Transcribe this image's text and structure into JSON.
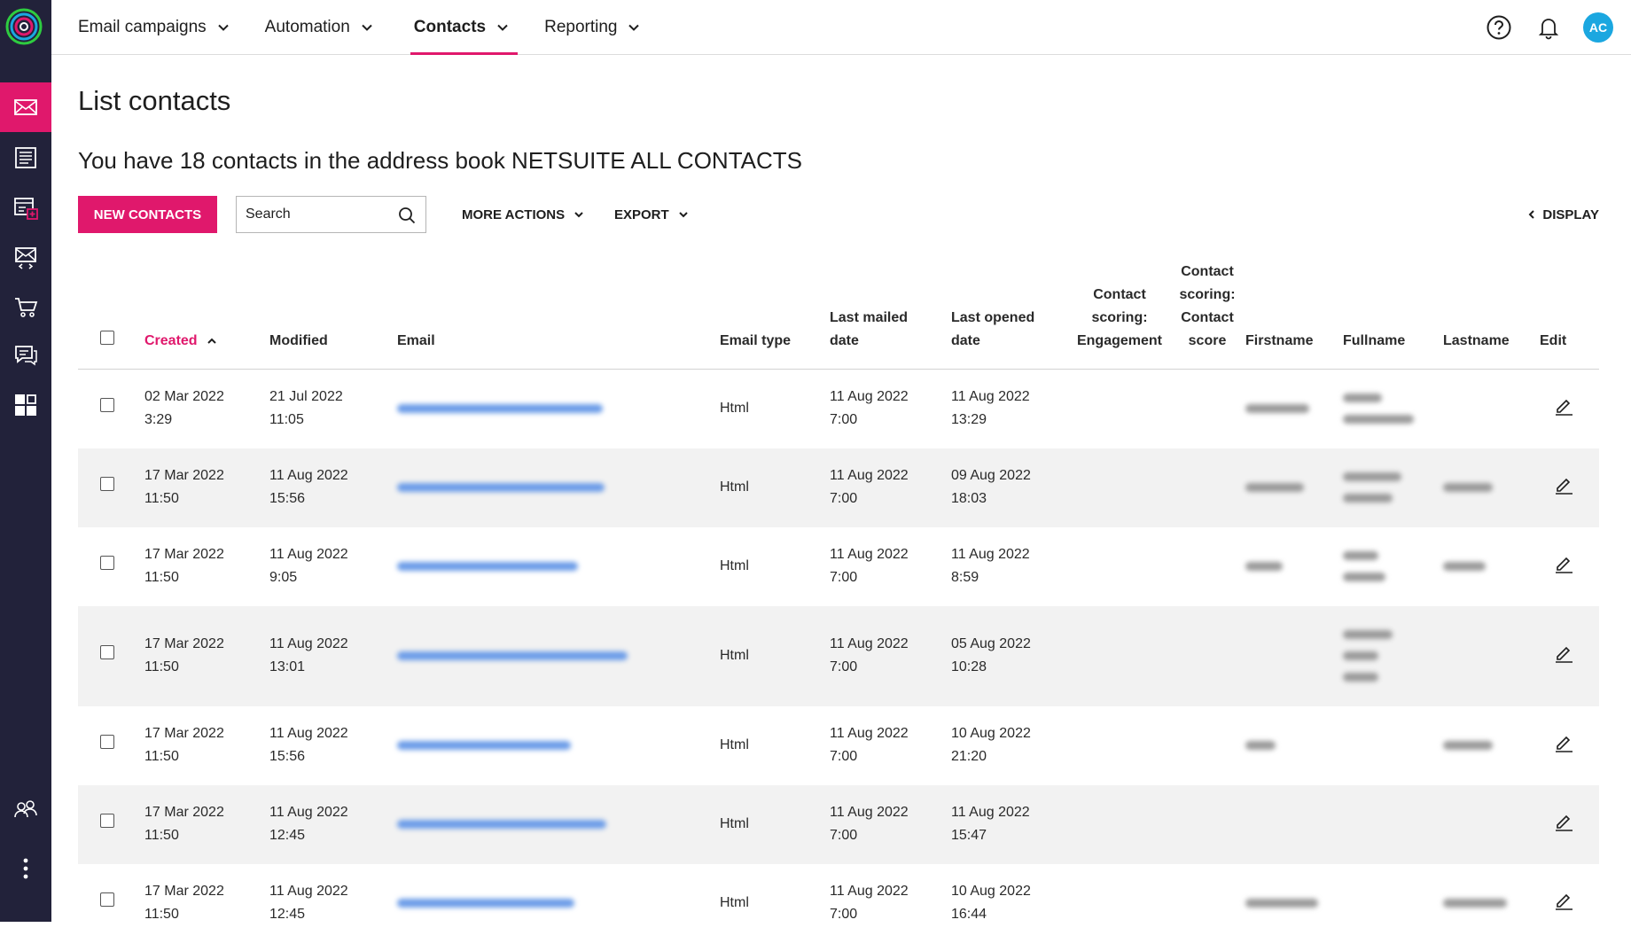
{
  "nav": {
    "items": [
      {
        "label": "Email campaigns",
        "active": false
      },
      {
        "label": "Automation",
        "active": false
      },
      {
        "label": "Contacts",
        "active": true
      },
      {
        "label": "Reporting",
        "active": false
      }
    ],
    "avatar_initials": "AC"
  },
  "colors": {
    "accent": "#e0186c",
    "rail": "#22223a",
    "avatar": "#1ba7e0"
  },
  "sidebar": {
    "icons": [
      "envelope-icon",
      "newsletter-icon",
      "forms-add-icon",
      "email-code-icon",
      "cart-icon",
      "chat-icon",
      "apps-grid-icon",
      "team-icon",
      "more-icon"
    ]
  },
  "page": {
    "title": "List contacts",
    "summary": "You have 18 contacts in the address book NETSUITE ALL CONTACTS"
  },
  "toolbar": {
    "new_contacts": "NEW CONTACTS",
    "search_placeholder": "Search",
    "more_actions": "MORE ACTIONS",
    "export": "EXPORT",
    "display": "DISPLAY"
  },
  "table": {
    "headers": {
      "created": "Created",
      "modified": "Modified",
      "email": "Email",
      "email_type": "Email type",
      "last_mailed_1": "Last mailed",
      "last_mailed_2": "date",
      "last_opened_1": "Last opened",
      "last_opened_2": "date",
      "engagement_1": "Contact",
      "engagement_2": "scoring:",
      "engagement_3": "Engagement",
      "score_1": "Contact",
      "score_2": "scoring:",
      "score_3": "Contact",
      "score_4": "score",
      "firstname": "Firstname",
      "fullname": "Fullname",
      "lastname": "Lastname",
      "edit": "Edit"
    },
    "rows": [
      {
        "created_d": "02 Mar 2022",
        "created_t": "3:29",
        "modified_d": "21 Jul 2022",
        "modified_t": "11:05",
        "email_type": "Html",
        "mailed_d": "11 Aug 2022",
        "mailed_t": "7:00",
        "opened_d": "11 Aug 2022",
        "opened_t": "13:29"
      },
      {
        "created_d": "17 Mar 2022",
        "created_t": "11:50",
        "modified_d": "11 Aug 2022",
        "modified_t": "15:56",
        "email_type": "Html",
        "mailed_d": "11 Aug 2022",
        "mailed_t": "7:00",
        "opened_d": "09 Aug 2022",
        "opened_t": "18:03"
      },
      {
        "created_d": "17 Mar 2022",
        "created_t": "11:50",
        "modified_d": "11 Aug 2022",
        "modified_t": "9:05",
        "email_type": "Html",
        "mailed_d": "11 Aug 2022",
        "mailed_t": "7:00",
        "opened_d": "11 Aug 2022",
        "opened_t": "8:59"
      },
      {
        "created_d": "17 Mar 2022",
        "created_t": "11:50",
        "modified_d": "11 Aug 2022",
        "modified_t": "13:01",
        "email_type": "Html",
        "mailed_d": "11 Aug 2022",
        "mailed_t": "7:00",
        "opened_d": "05 Aug 2022",
        "opened_t": "10:28"
      },
      {
        "created_d": "17 Mar 2022",
        "created_t": "11:50",
        "modified_d": "11 Aug 2022",
        "modified_t": "15:56",
        "email_type": "Html",
        "mailed_d": "11 Aug 2022",
        "mailed_t": "7:00",
        "opened_d": "10 Aug 2022",
        "opened_t": "21:20"
      },
      {
        "created_d": "17 Mar 2022",
        "created_t": "11:50",
        "modified_d": "11 Aug 2022",
        "modified_t": "12:45",
        "email_type": "Html",
        "mailed_d": "11 Aug 2022",
        "mailed_t": "7:00",
        "opened_d": "11 Aug 2022",
        "opened_t": "15:47"
      },
      {
        "created_d": "17 Mar 2022",
        "created_t": "11:50",
        "modified_d": "11 Aug 2022",
        "modified_t": "12:45",
        "email_type": "Html",
        "mailed_d": "11 Aug 2022",
        "mailed_t": "7:00",
        "opened_d": "10 Aug 2022",
        "opened_t": "16:44"
      }
    ]
  }
}
